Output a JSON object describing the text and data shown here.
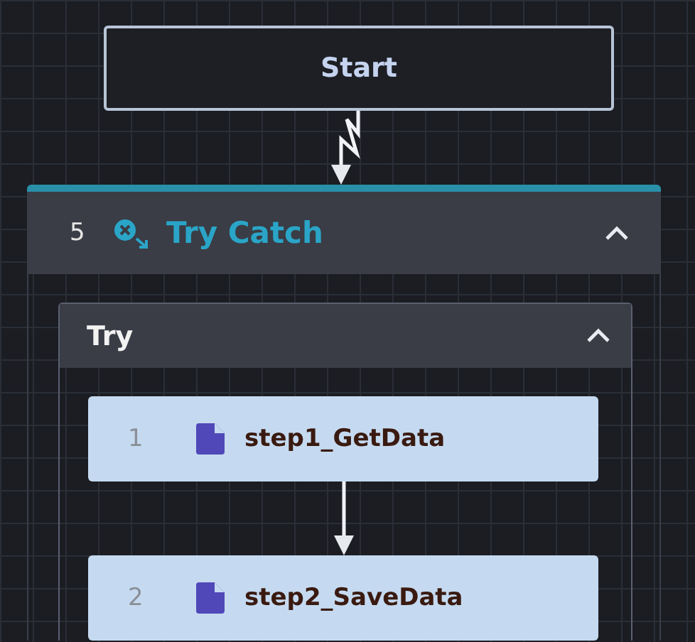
{
  "start_node": {
    "label": "Start"
  },
  "try_catch": {
    "number": "5",
    "title": "Try Catch",
    "expanded": true,
    "try_block": {
      "title": "Try",
      "expanded": true,
      "steps": [
        {
          "number": "1",
          "label": "step1_GetData"
        },
        {
          "number": "2",
          "label": "step2_SaveData"
        }
      ]
    }
  }
}
